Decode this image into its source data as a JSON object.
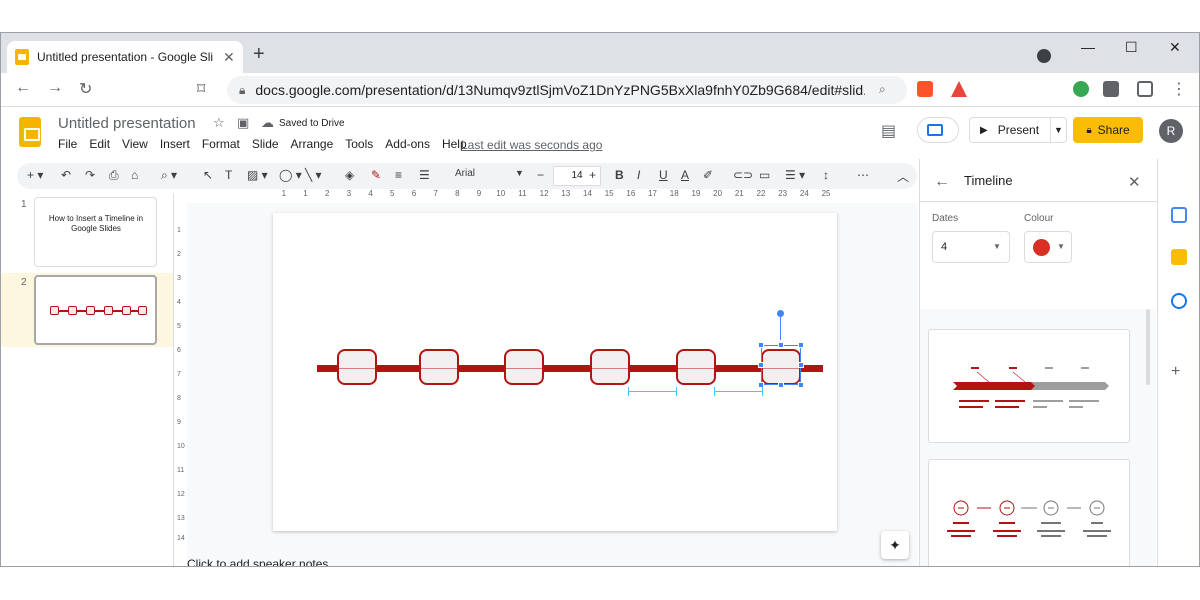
{
  "browser": {
    "tab_title": "Untitled presentation - Google Sli",
    "url": "docs.google.com/presentation/d/13Numqv9ztlSjmVoZ1DnYzPNG5BxXla9fnhY0Zb9G684/edit#slid..."
  },
  "app": {
    "doc_title": "Untitled presentation",
    "saved_status": "Saved to Drive",
    "menus": [
      "File",
      "Edit",
      "View",
      "Insert",
      "Format",
      "Slide",
      "Arrange",
      "Tools",
      "Add-ons",
      "Help"
    ],
    "last_edit": "Last edit was seconds ago",
    "present_label": "Present",
    "share_label": "Share",
    "avatar_initial": "R"
  },
  "toolbar": {
    "font": "Arial",
    "font_size": "14"
  },
  "filmstrip": {
    "slides": [
      {
        "num": "1",
        "title": "How to Insert a Timeline in Google Slides"
      },
      {
        "num": "2",
        "title": ""
      }
    ]
  },
  "ruler": {
    "h_ticks": [
      "1",
      "1",
      "2",
      "3",
      "4",
      "5",
      "6",
      "7",
      "8",
      "9",
      "10",
      "11",
      "12",
      "13",
      "14",
      "15",
      "16",
      "17",
      "18",
      "19",
      "20",
      "21",
      "22",
      "23",
      "24",
      "25"
    ],
    "v_ticks": [
      "1",
      "2",
      "3",
      "4",
      "5",
      "6",
      "7",
      "8",
      "9",
      "10",
      "11",
      "12",
      "13",
      "14"
    ]
  },
  "notes_placeholder": "Click to add speaker notes",
  "panel": {
    "title": "Timeline",
    "dates_label": "Dates",
    "dates_value": "4",
    "colour_label": "Colour",
    "colour_value": "#d93025"
  },
  "colors": {
    "timeline_red": "#b31412",
    "selection_blue": "#4285f4",
    "share_yellow": "#fbbc04"
  }
}
